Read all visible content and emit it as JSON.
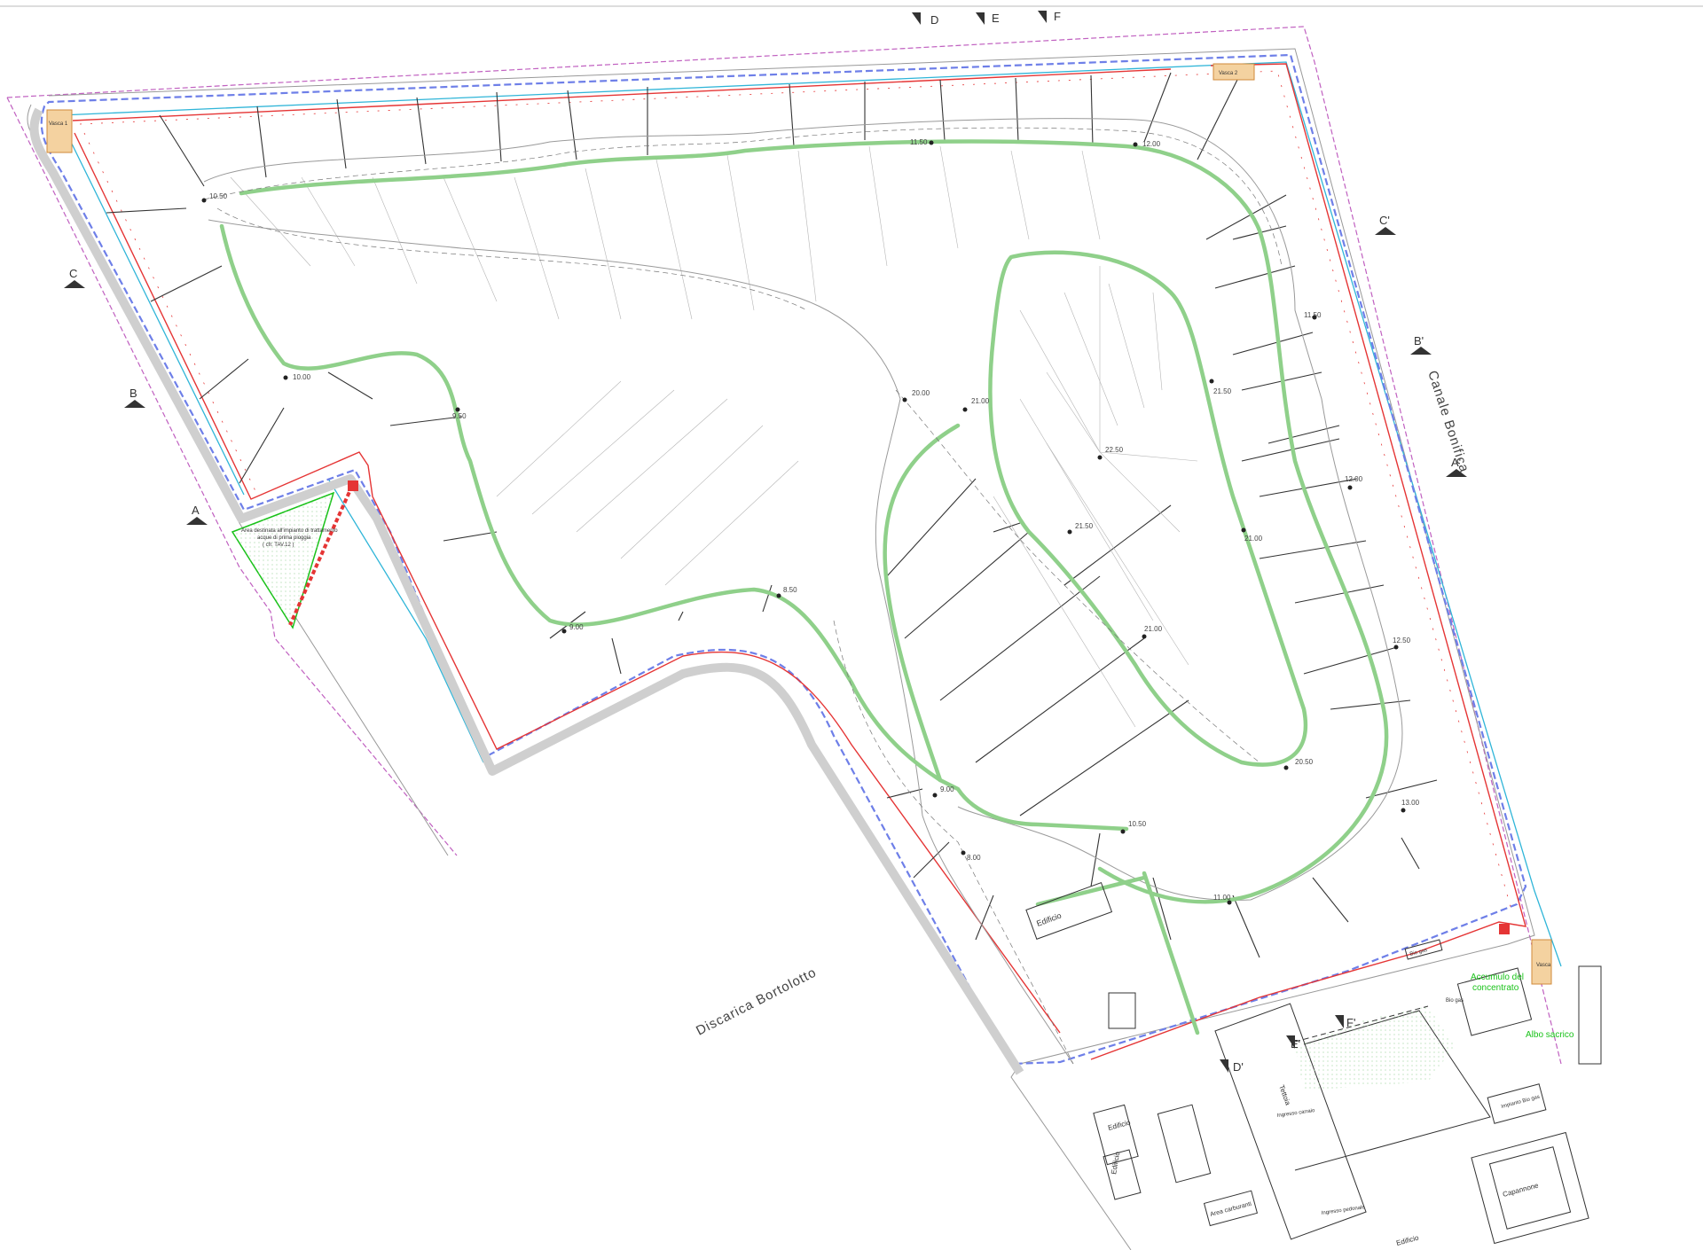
{
  "labels": {
    "canale": "Canale Bonifica",
    "discarica": "Discarica Bortolotto",
    "area_line1": "Area destinata all'impianto di trattamento",
    "area_line2": "acque di prima pioggia",
    "area_line3": "( cfr. TAV.12 )",
    "accumulo_line1": "Accumulo del",
    "accumulo_line2": "concentrato",
    "albo": "Albo sacrico",
    "edificio1": "Edificio",
    "edificio2": "Edificio",
    "edificio3": "Edificio",
    "edificio4": "Edificio",
    "tettoia": "Tettoia",
    "capannone": "Capannone",
    "area_carburanti": "Area carburanti",
    "ingresso_carraio": "Ingresso carraio",
    "ingresso_pedonale": "Ingresso pedonale",
    "vasca1": "Vasca 1",
    "vasca2": "Vasca 2",
    "vasca3": "Vasca",
    "biogas1": "Bio gas",
    "biogas2": "Impianto Bio gas",
    "biogas3": "Bio gas"
  },
  "sections": {
    "A": "A",
    "B": "B",
    "C": "C",
    "D": "D",
    "E": "E",
    "F": "F",
    "A2": "A'",
    "B2": "B'",
    "C2": "C'",
    "D2": "D'",
    "E2": "E'",
    "F2": "F'"
  },
  "elevations": {
    "e1": "10.50",
    "e2": "11.50",
    "e3": "12.00",
    "e4": "10.00",
    "e5": "9.50",
    "e6": "20.00",
    "e7": "21.00",
    "e8": "22.50",
    "e9": "21.50",
    "e10": "21.50",
    "e11": "21.00",
    "e12": "21.00",
    "e13": "11.50",
    "e14": "12.00",
    "e15": "12.50",
    "e16": "13.00",
    "e17": "20.50",
    "e18": "10.50",
    "e19": "11.00",
    "e20": "9.00",
    "e21": "8.50",
    "e22": "9.00",
    "e23": "8.00"
  },
  "colors": {
    "red_line": "#e53535",
    "blue_line": "#2a63d6",
    "cyan_line": "#2fb5d8",
    "green_road": "#8fd08a",
    "magenta_boundary": "#c060c0",
    "green_text": "#19c219"
  }
}
